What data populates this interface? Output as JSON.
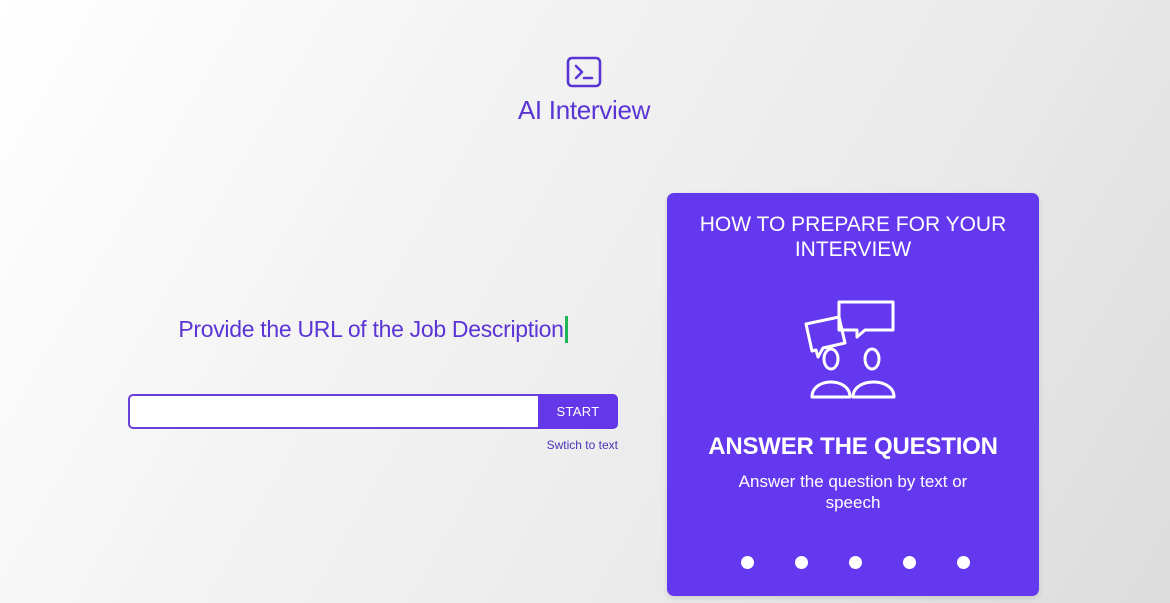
{
  "header": {
    "logo_icon": "terminal-icon",
    "title": "AI Interview"
  },
  "main": {
    "prompt": "Provide the URL of the Job Description",
    "url_input": {
      "value": "",
      "placeholder": ""
    },
    "start_label": "START",
    "switch_label": "Swtich to text"
  },
  "guide": {
    "heading": "HOW TO PREPARE FOR YOUR INTERVIEW",
    "slide": {
      "icon": "conversation-icon",
      "title": "ANSWER THE QUESTION",
      "description": "Answer the question by text or speech"
    },
    "dots_count": 5,
    "active_dot": 3
  },
  "colors": {
    "accent": "#5b34d6",
    "card_background": "#6438ef",
    "button_background": "#6438e8",
    "cursor": "#1fb457"
  }
}
